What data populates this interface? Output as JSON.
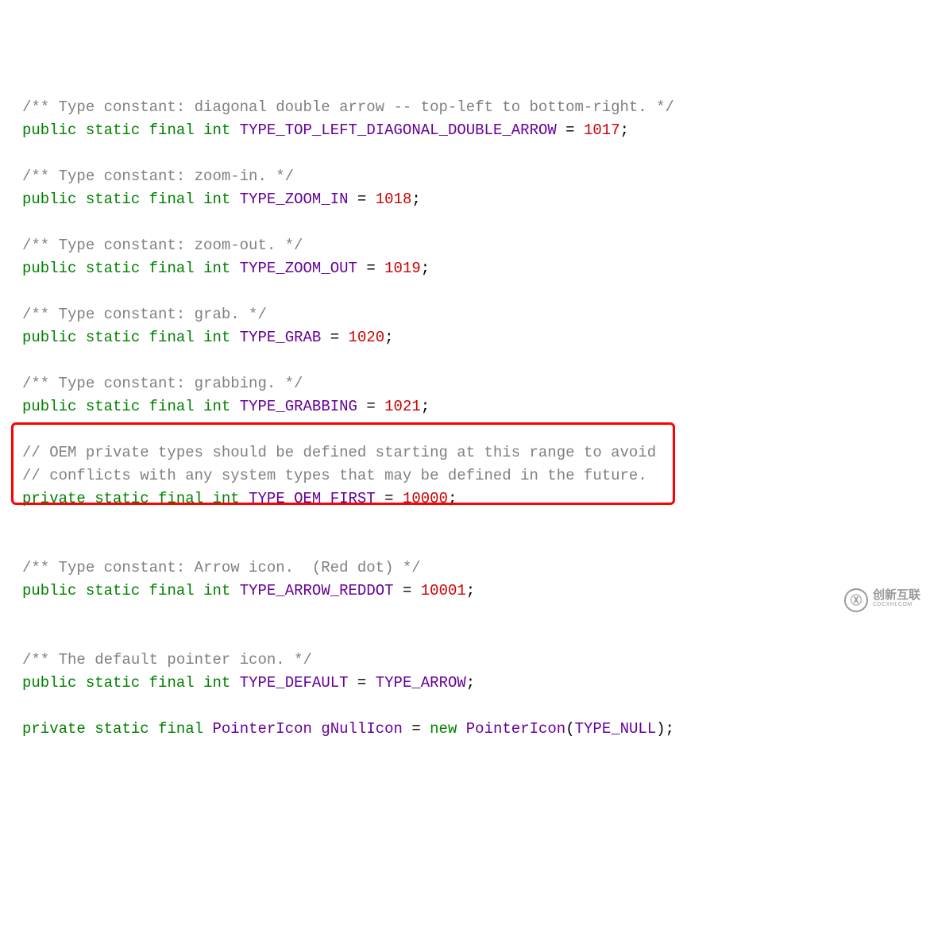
{
  "line1_comment": "/** Type constant: diagonal double arrow -- top-left to bottom-right. */",
  "kw_public": "public",
  "kw_private": "private",
  "kw_static": "static",
  "kw_final": "final",
  "kw_int": "int",
  "kw_new": "new",
  "eq": " = ",
  "semi": ";",
  "lp": "(",
  "rp": ")",
  "id_tl": "TYPE_TOP_LEFT_DIAGONAL_DOUBLE_ARROW",
  "val_tl": "1017",
  "c_zoom_in": "/** Type constant: zoom-in. */",
  "id_zoom_in": "TYPE_ZOOM_IN",
  "val_zoom_in": "1018",
  "c_zoom_out": "/** Type constant: zoom-out. */",
  "id_zoom_out": "TYPE_ZOOM_OUT",
  "val_zoom_out": "1019",
  "c_grab": "/** Type constant: grab. */",
  "id_grab": "TYPE_GRAB",
  "val_grab": "1020",
  "c_grabbing": "/** Type constant: grabbing. */",
  "id_grabbing": "TYPE_GRABBING",
  "val_grabbing": "1021",
  "c_oem_1": "// OEM private types should be defined starting at this range to avoid",
  "c_oem_2": "// conflicts with any system types that may be defined in the future.",
  "id_oem": "TYPE_OEM_FIRST",
  "val_oem": "10000",
  "c_reddot": "/** Type constant: Arrow icon.  (Red dot) */",
  "id_reddot": "TYPE_ARROW_REDDOT",
  "val_reddot": "10001",
  "c_default": "/** The default pointer icon. */",
  "id_default": "TYPE_DEFAULT",
  "id_arrow": "TYPE_ARROW",
  "id_ptricon": "PointerIcon",
  "id_gnull": "gNullIcon",
  "id_typenull": "TYPE_NULL",
  "wm_main": "创新互联",
  "wm_sub": "CDCXHLCOM",
  "wm_logo": "Ⓧ"
}
